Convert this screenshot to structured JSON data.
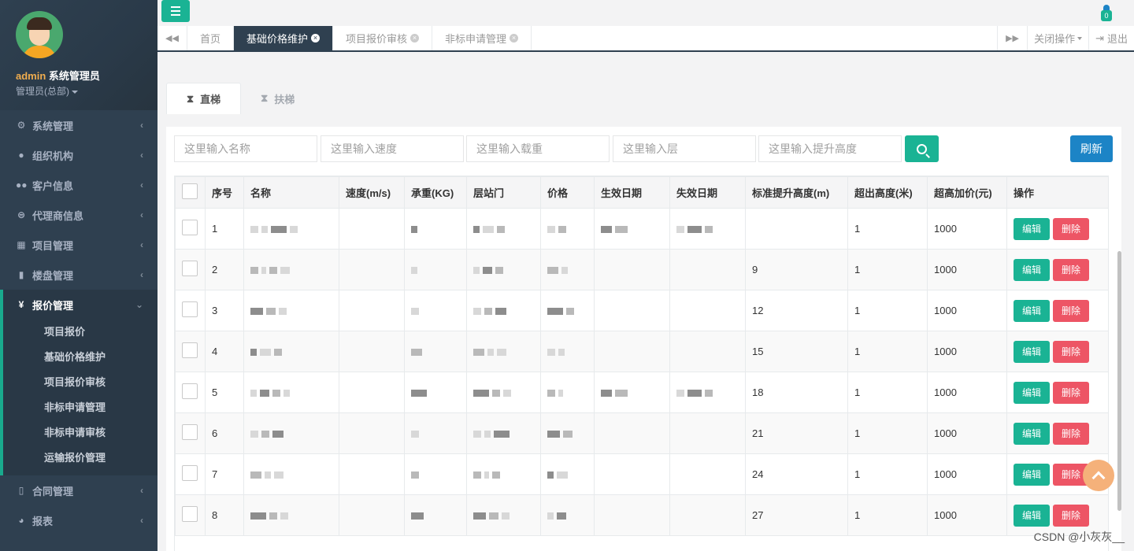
{
  "user": {
    "name": "admin",
    "title": "系统管理员",
    "role": "管理员(总部)"
  },
  "sidebar": {
    "items": [
      {
        "label": "系统管理",
        "icon": "gear-icon"
      },
      {
        "label": "组织机构",
        "icon": "user-icon"
      },
      {
        "label": "客户信息",
        "icon": "users-icon"
      },
      {
        "label": "代理商信息",
        "icon": "car-icon"
      },
      {
        "label": "项目管理",
        "icon": "grid-icon"
      },
      {
        "label": "楼盘管理",
        "icon": "book-icon"
      },
      {
        "label": "报价管理",
        "icon": "yen-icon"
      },
      {
        "label": "合同管理",
        "icon": "file-icon"
      },
      {
        "label": "报表",
        "icon": "pie-chart-icon"
      }
    ],
    "sub_items": [
      "项目报价",
      "基础价格维护",
      "项目报价审核",
      "非标申请管理",
      "非标申请审核",
      "运输报价管理"
    ]
  },
  "topbar": {
    "badge": "0"
  },
  "tabs": {
    "home": "首页",
    "items": [
      "基础价格维护",
      "项目报价审核",
      "非标申请管理"
    ],
    "close_ops": "关闭操作",
    "logout": "退出"
  },
  "page_tabs": [
    "直梯",
    "扶梯"
  ],
  "search": {
    "name_ph": "这里输入名称",
    "speed_ph": "这里输入速度",
    "load_ph": "这里输入载重",
    "floor_ph": "这里输入层",
    "height_ph": "这里输入提升高度",
    "refresh": "刷新"
  },
  "table": {
    "headers": [
      "序号",
      "名称",
      "速度(m/s)",
      "承重(KG)",
      "层站门",
      "价格",
      "生效日期",
      "失效日期",
      "标准提升高度(m)",
      "超出高度(米)",
      "超高加价(元)",
      "操作"
    ],
    "rows": [
      {
        "no": "1",
        "std_height": "",
        "over_height": "1",
        "surcharge": "1000"
      },
      {
        "no": "2",
        "std_height": "9",
        "over_height": "1",
        "surcharge": "1000"
      },
      {
        "no": "3",
        "std_height": "12",
        "over_height": "1",
        "surcharge": "1000"
      },
      {
        "no": "4",
        "std_height": "15",
        "over_height": "1",
        "surcharge": "1000"
      },
      {
        "no": "5",
        "std_height": "18",
        "over_height": "1",
        "surcharge": "1000"
      },
      {
        "no": "6",
        "std_height": "21",
        "over_height": "1",
        "surcharge": "1000"
      },
      {
        "no": "7",
        "std_height": "24",
        "over_height": "1",
        "surcharge": "1000"
      },
      {
        "no": "8",
        "std_height": "27",
        "over_height": "1",
        "surcharge": "1000"
      }
    ],
    "edit_label": "编辑",
    "delete_label": "删除"
  },
  "watermark": "CSDN @小灰灰__"
}
